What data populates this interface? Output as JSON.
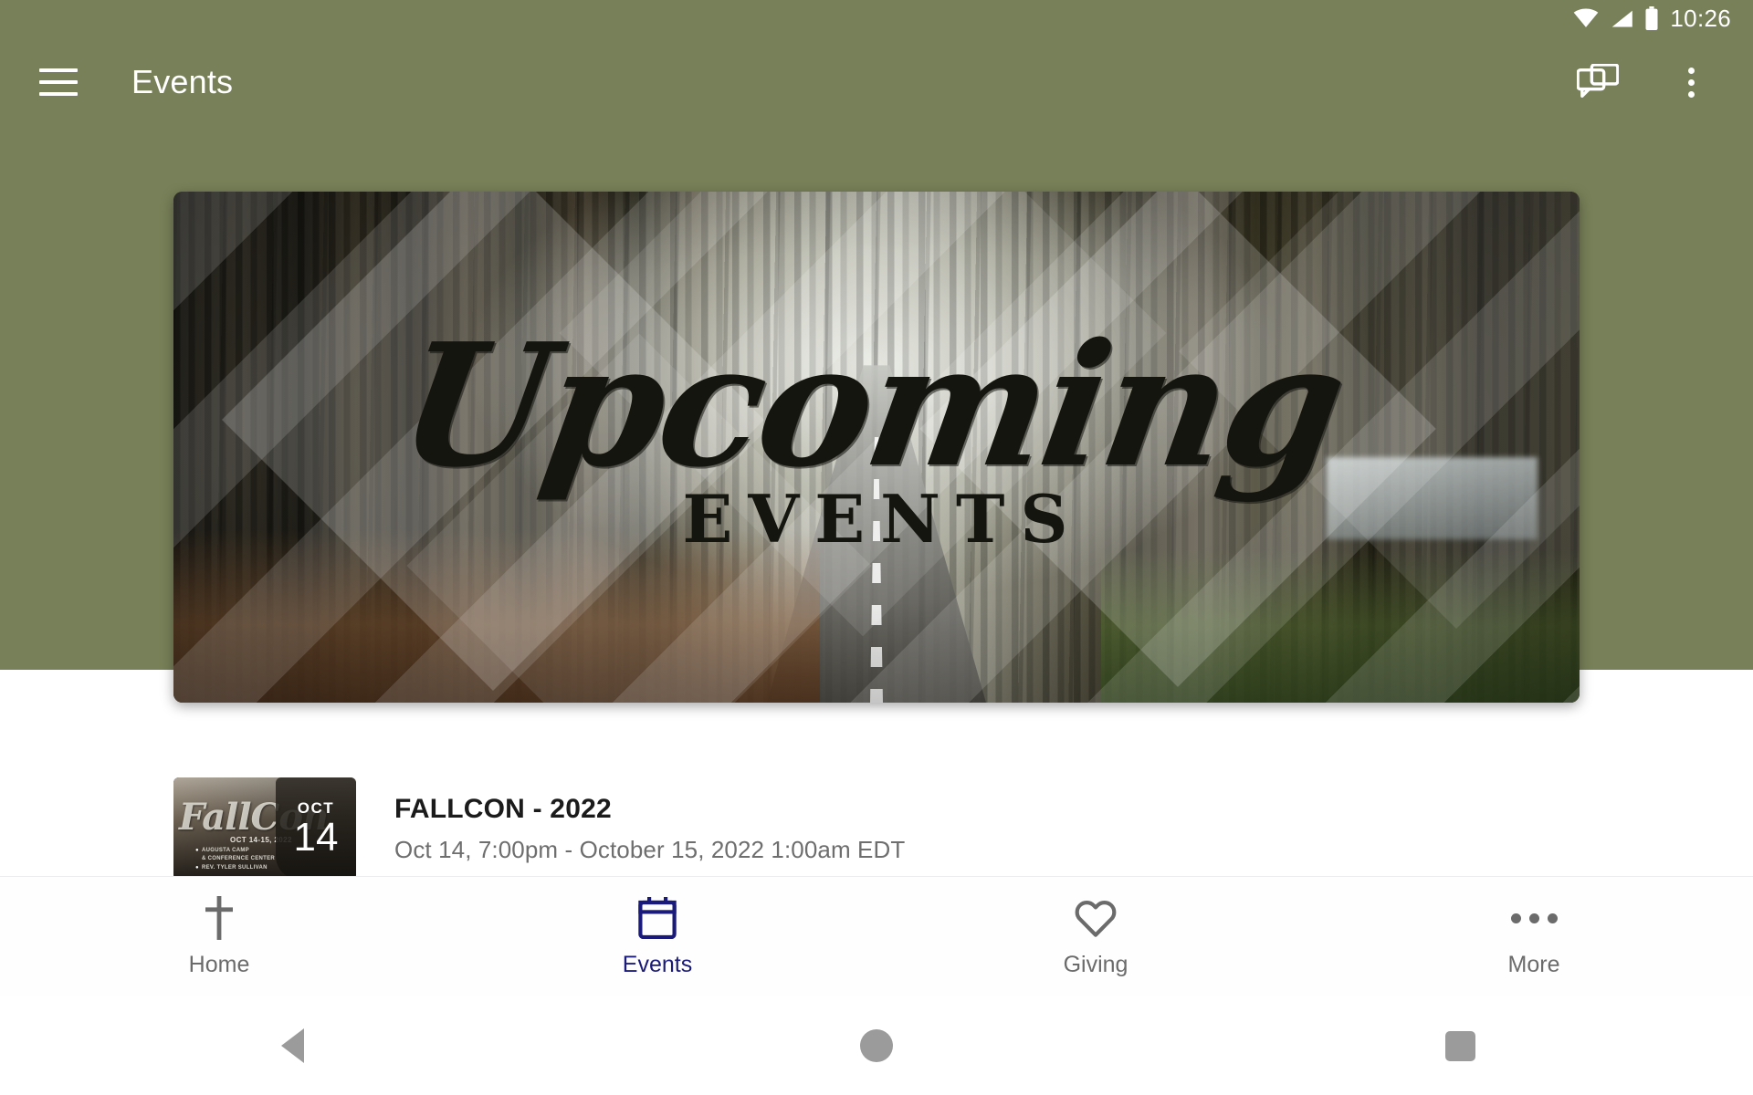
{
  "status_bar": {
    "time": "10:26",
    "icons": [
      "wifi-icon",
      "cellular-signal-icon",
      "battery-icon"
    ]
  },
  "app_bar": {
    "menu_icon": "hamburger-menu-icon",
    "title": "Events",
    "actions": [
      {
        "name": "chat-bubbles-icon",
        "label": "Messages"
      },
      {
        "name": "overflow-menu-icon",
        "label": "More options"
      }
    ],
    "background_color": "#788059"
  },
  "hero": {
    "script_text": "Upcoming",
    "serif_text": "EVENTS",
    "alt": "Forest road banner with Upcoming Events lettering"
  },
  "events": [
    {
      "title": "FALLCON - 2022",
      "datetime": "Oct 14, 7:00pm - October 15, 2022 1:00am EDT",
      "badge_month": "OCT",
      "badge_day": "14",
      "thumb": {
        "script": "FallCon",
        "date_line": "OCT 14-15, 2022",
        "venue": "AUGUSTA CAMP\n& CONFERENCE CENTER",
        "venue_line1": "AUGUSTA CAMP",
        "venue_line2": "& CONFERENCE CENTER",
        "speaker": "REV. TYLER SULLIVAN"
      }
    }
  ],
  "bottom_nav": {
    "active_color": "#1a1a7a",
    "inactive_color": "#6b6b6b",
    "tabs": [
      {
        "label": "Home",
        "icon": "cross-icon",
        "active": false
      },
      {
        "label": "Events",
        "icon": "calendar-icon",
        "active": true
      },
      {
        "label": "Giving",
        "icon": "heart-icon",
        "active": false
      },
      {
        "label": "More",
        "icon": "ellipsis-icon",
        "active": false
      }
    ]
  },
  "android_nav": {
    "back": "back-triangle-icon",
    "home": "home-circle-icon",
    "recents": "recents-square-icon"
  }
}
